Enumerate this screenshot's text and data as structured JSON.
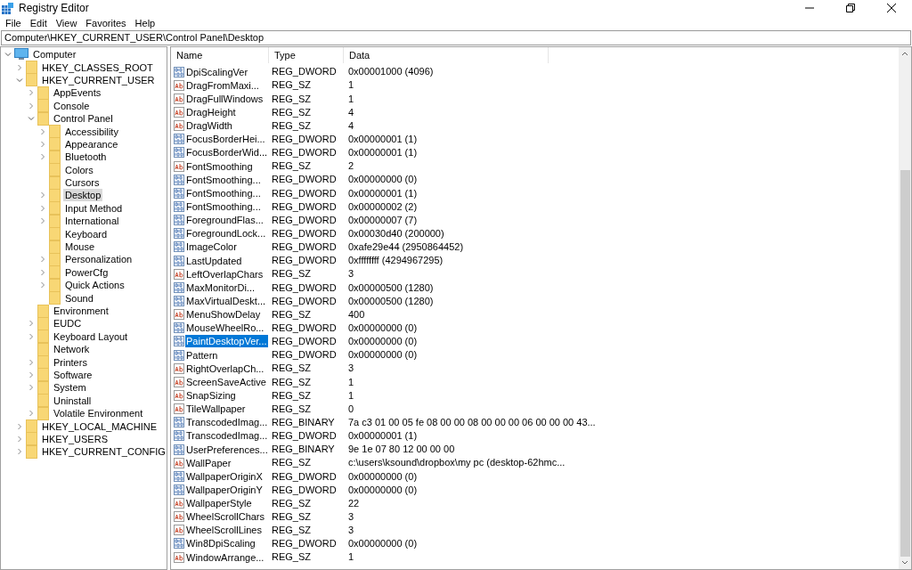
{
  "window": {
    "title": "Registry Editor"
  },
  "menu": [
    "File",
    "Edit",
    "View",
    "Favorites",
    "Help"
  ],
  "address": "Computer\\HKEY_CURRENT_USER\\Control Panel\\Desktop",
  "tree": [
    {
      "label": "Computer",
      "kind": "computer",
      "expanded": true,
      "selected": false,
      "children": [
        {
          "label": "HKEY_CLASSES_ROOT",
          "kind": "folder",
          "expanded": false,
          "selected": false
        },
        {
          "label": "HKEY_CURRENT_USER",
          "kind": "folder",
          "expanded": true,
          "selected": false,
          "children": [
            {
              "label": "AppEvents",
              "kind": "folder",
              "expanded": false,
              "selected": false
            },
            {
              "label": "Console",
              "kind": "folder",
              "expanded": false,
              "selected": false
            },
            {
              "label": "Control Panel",
              "kind": "folder",
              "expanded": true,
              "selected": false,
              "children": [
                {
                  "label": "Accessibility",
                  "kind": "folder",
                  "expanded": false,
                  "selected": false
                },
                {
                  "label": "Appearance",
                  "kind": "folder",
                  "expanded": false,
                  "selected": false
                },
                {
                  "label": "Bluetooth",
                  "kind": "folder",
                  "expanded": false,
                  "selected": false
                },
                {
                  "label": "Colors",
                  "kind": "folder",
                  "selected": false
                },
                {
                  "label": "Cursors",
                  "kind": "folder",
                  "selected": false
                },
                {
                  "label": "Desktop",
                  "kind": "folder",
                  "expanded": false,
                  "selected": true
                },
                {
                  "label": "Input Method",
                  "kind": "folder",
                  "expanded": false,
                  "selected": false
                },
                {
                  "label": "International",
                  "kind": "folder",
                  "expanded": false,
                  "selected": false
                },
                {
                  "label": "Keyboard",
                  "kind": "folder",
                  "selected": false
                },
                {
                  "label": "Mouse",
                  "kind": "folder",
                  "selected": false
                },
                {
                  "label": "Personalization",
                  "kind": "folder",
                  "expanded": false,
                  "selected": false
                },
                {
                  "label": "PowerCfg",
                  "kind": "folder",
                  "expanded": false,
                  "selected": false
                },
                {
                  "label": "Quick Actions",
                  "kind": "folder",
                  "expanded": false,
                  "selected": false
                },
                {
                  "label": "Sound",
                  "kind": "folder",
                  "selected": false
                }
              ]
            },
            {
              "label": "Environment",
              "kind": "folder",
              "selected": false
            },
            {
              "label": "EUDC",
              "kind": "folder",
              "expanded": false,
              "selected": false
            },
            {
              "label": "Keyboard Layout",
              "kind": "folder",
              "expanded": false,
              "selected": false
            },
            {
              "label": "Network",
              "kind": "folder",
              "selected": false
            },
            {
              "label": "Printers",
              "kind": "folder",
              "expanded": false,
              "selected": false
            },
            {
              "label": "Software",
              "kind": "folder",
              "expanded": false,
              "selected": false
            },
            {
              "label": "System",
              "kind": "folder",
              "expanded": false,
              "selected": false
            },
            {
              "label": "Uninstall",
              "kind": "folder",
              "selected": false
            },
            {
              "label": "Volatile Environment",
              "kind": "folder",
              "expanded": false,
              "selected": false
            }
          ]
        },
        {
          "label": "HKEY_LOCAL_MACHINE",
          "kind": "folder",
          "expanded": false,
          "selected": false
        },
        {
          "label": "HKEY_USERS",
          "kind": "folder",
          "expanded": false,
          "selected": false
        },
        {
          "label": "HKEY_CURRENT_CONFIG",
          "kind": "folder",
          "expanded": false,
          "selected": false
        }
      ]
    }
  ],
  "columns": [
    "Name",
    "Type",
    "Data"
  ],
  "values": [
    {
      "name": "DpiScalingVer",
      "kind": "binary",
      "type": "REG_DWORD",
      "data": "0x00001000 (4096)",
      "selected": false
    },
    {
      "name": "DragFromMaxi...",
      "kind": "string",
      "type": "REG_SZ",
      "data": "1",
      "selected": false
    },
    {
      "name": "DragFullWindows",
      "kind": "string",
      "type": "REG_SZ",
      "data": "1",
      "selected": false
    },
    {
      "name": "DragHeight",
      "kind": "string",
      "type": "REG_SZ",
      "data": "4",
      "selected": false
    },
    {
      "name": "DragWidth",
      "kind": "string",
      "type": "REG_SZ",
      "data": "4",
      "selected": false
    },
    {
      "name": "FocusBorderHei...",
      "kind": "binary",
      "type": "REG_DWORD",
      "data": "0x00000001 (1)",
      "selected": false
    },
    {
      "name": "FocusBorderWid...",
      "kind": "binary",
      "type": "REG_DWORD",
      "data": "0x00000001 (1)",
      "selected": false
    },
    {
      "name": "FontSmoothing",
      "kind": "string",
      "type": "REG_SZ",
      "data": "2",
      "selected": false
    },
    {
      "name": "FontSmoothing...",
      "kind": "binary",
      "type": "REG_DWORD",
      "data": "0x00000000 (0)",
      "selected": false
    },
    {
      "name": "FontSmoothing...",
      "kind": "binary",
      "type": "REG_DWORD",
      "data": "0x00000001 (1)",
      "selected": false
    },
    {
      "name": "FontSmoothing...",
      "kind": "binary",
      "type": "REG_DWORD",
      "data": "0x00000002 (2)",
      "selected": false
    },
    {
      "name": "ForegroundFlas...",
      "kind": "binary",
      "type": "REG_DWORD",
      "data": "0x00000007 (7)",
      "selected": false
    },
    {
      "name": "ForegroundLock...",
      "kind": "binary",
      "type": "REG_DWORD",
      "data": "0x00030d40 (200000)",
      "selected": false
    },
    {
      "name": "ImageColor",
      "kind": "binary",
      "type": "REG_DWORD",
      "data": "0xafe29e44 (2950864452)",
      "selected": false
    },
    {
      "name": "LastUpdated",
      "kind": "binary",
      "type": "REG_DWORD",
      "data": "0xffffffff (4294967295)",
      "selected": false
    },
    {
      "name": "LeftOverlapChars",
      "kind": "string",
      "type": "REG_SZ",
      "data": "3",
      "selected": false
    },
    {
      "name": "MaxMonitorDi...",
      "kind": "binary",
      "type": "REG_DWORD",
      "data": "0x00000500 (1280)",
      "selected": false
    },
    {
      "name": "MaxVirtualDeskt...",
      "kind": "binary",
      "type": "REG_DWORD",
      "data": "0x00000500 (1280)",
      "selected": false
    },
    {
      "name": "MenuShowDelay",
      "kind": "string",
      "type": "REG_SZ",
      "data": "400",
      "selected": false
    },
    {
      "name": "MouseWheelRo...",
      "kind": "binary",
      "type": "REG_DWORD",
      "data": "0x00000000 (0)",
      "selected": false
    },
    {
      "name": "PaintDesktopVer...",
      "kind": "binary",
      "type": "REG_DWORD",
      "data": "0x00000000 (0)",
      "selected": true
    },
    {
      "name": "Pattern",
      "kind": "binary",
      "type": "REG_DWORD",
      "data": "0x00000000 (0)",
      "selected": false
    },
    {
      "name": "RightOverlapCh...",
      "kind": "string",
      "type": "REG_SZ",
      "data": "3",
      "selected": false
    },
    {
      "name": "ScreenSaveActive",
      "kind": "string",
      "type": "REG_SZ",
      "data": "1",
      "selected": false
    },
    {
      "name": "SnapSizing",
      "kind": "string",
      "type": "REG_SZ",
      "data": "1",
      "selected": false
    },
    {
      "name": "TileWallpaper",
      "kind": "string",
      "type": "REG_SZ",
      "data": "0",
      "selected": false
    },
    {
      "name": "TranscodedImag...",
      "kind": "binary",
      "type": "REG_BINARY",
      "data": "7a c3 01 00 05 fe 08 00 00 08 00 00 00 06 00 00 00 43...",
      "selected": false
    },
    {
      "name": "TranscodedImag...",
      "kind": "binary",
      "type": "REG_DWORD",
      "data": "0x00000001 (1)",
      "selected": false
    },
    {
      "name": "UserPreferences...",
      "kind": "binary",
      "type": "REG_BINARY",
      "data": "9e 1e 07 80 12 00 00 00",
      "selected": false
    },
    {
      "name": "WallPaper",
      "kind": "string",
      "type": "REG_SZ",
      "data": "c:\\users\\ksound\\dropbox\\my pc (desktop-62hmc...",
      "selected": false
    },
    {
      "name": "WallpaperOriginX",
      "kind": "binary",
      "type": "REG_DWORD",
      "data": "0x00000000 (0)",
      "selected": false
    },
    {
      "name": "WallpaperOriginY",
      "kind": "binary",
      "type": "REG_DWORD",
      "data": "0x00000000 (0)",
      "selected": false
    },
    {
      "name": "WallpaperStyle",
      "kind": "string",
      "type": "REG_SZ",
      "data": "22",
      "selected": false
    },
    {
      "name": "WheelScrollChars",
      "kind": "string",
      "type": "REG_SZ",
      "data": "3",
      "selected": false
    },
    {
      "name": "WheelScrollLines",
      "kind": "string",
      "type": "REG_SZ",
      "data": "3",
      "selected": false
    },
    {
      "name": "Win8DpiScaling",
      "kind": "binary",
      "type": "REG_DWORD",
      "data": "0x00000000 (0)",
      "selected": false
    },
    {
      "name": "WindowArrange...",
      "kind": "string",
      "type": "REG_SZ",
      "data": "1",
      "selected": false
    }
  ]
}
